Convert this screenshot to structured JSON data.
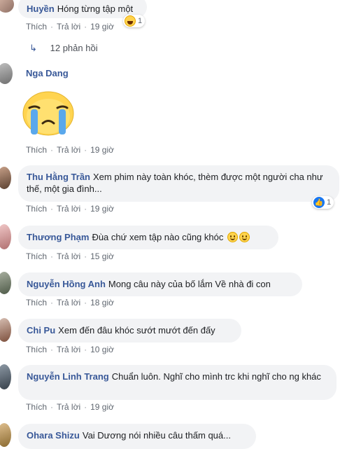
{
  "actions": {
    "like": "Thích",
    "reply": "Trả lời",
    "dot": "·"
  },
  "replies_link": "12 phản hồi",
  "comments": [
    {
      "author": "Huyền",
      "text": "Hóng từng tập một",
      "time": "19 giờ",
      "reaction_count": "1"
    },
    {
      "author": "Nga Dang",
      "text": "",
      "time": "19 giờ",
      "sticker": "crying-sticker"
    },
    {
      "author": "Thu Hằng Trần",
      "text": "Xem phim này toàn khóc, thèm được một người cha như thế, một gia đình...",
      "time": "19 giờ",
      "reaction_count": "1"
    },
    {
      "author": "Thương Phạm",
      "text": "Đùa chứ xem tập nào cũng khóc",
      "time": "15 giờ"
    },
    {
      "author": "Nguyễn Hồng Anh",
      "text": "Mong câu này của bố lắm Về nhà đi con",
      "time": "18 giờ"
    },
    {
      "author": "Chi Pu",
      "text": "Xem đến đâu khóc sướt mướt đến đấy",
      "time": "10 giờ"
    },
    {
      "author": "Nguyễn Linh Trang",
      "text": "Chuẩn luôn. Nghĩ cho mình trc khi nghĩ cho ng khác",
      "time": "19 giờ"
    },
    {
      "author": "Ohara Shizu",
      "text": "Vai Dương nói nhiều câu thấm quá...",
      "time": ""
    }
  ],
  "colors": {
    "author": "#385898",
    "bubble": "#f2f3f5",
    "meta": "#606770",
    "like_badge": "#1877f2"
  }
}
